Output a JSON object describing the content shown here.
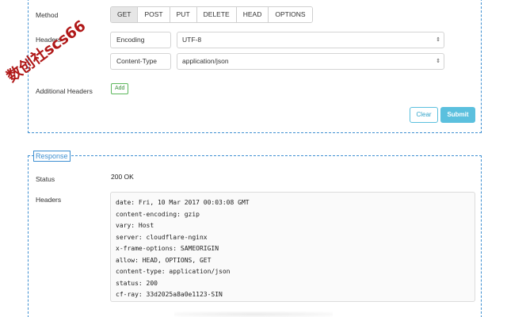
{
  "request": {
    "method_label": "Method",
    "methods": [
      {
        "label": "GET",
        "active": true
      },
      {
        "label": "POST",
        "active": false
      },
      {
        "label": "PUT",
        "active": false
      },
      {
        "label": "DELETE",
        "active": false
      },
      {
        "label": "HEAD",
        "active": false
      },
      {
        "label": "OPTIONS",
        "active": false
      }
    ],
    "headers_label": "Headers",
    "headers": [
      {
        "key": "Encoding",
        "value": "UTF-8"
      },
      {
        "key": "Content-Type",
        "value": "application/json"
      }
    ],
    "additional_headers_label": "Additional Headers",
    "add_label": "Add",
    "clear_label": "Clear",
    "submit_label": "Submit"
  },
  "response": {
    "legend": "Response",
    "status_label": "Status",
    "status_value": "200 OK",
    "headers_label": "Headers",
    "header_lines": [
      "date: Fri, 10 Mar 2017 00:03:08 GMT",
      "content-encoding: gzip",
      "vary: Host",
      "server: cloudflare-nginx",
      "x-frame-options: SAMEORIGIN",
      "allow: HEAD, OPTIONS, GET",
      "content-type: application/json",
      "status: 200",
      "cf-ray: 33d2025a8a0e1123-SIN"
    ]
  },
  "watermark": "数创社scs66",
  "colors": {
    "accent": "#3d8fd1",
    "info": "#5bc0de",
    "success": "#5cb85c",
    "watermark": "#b01818"
  }
}
